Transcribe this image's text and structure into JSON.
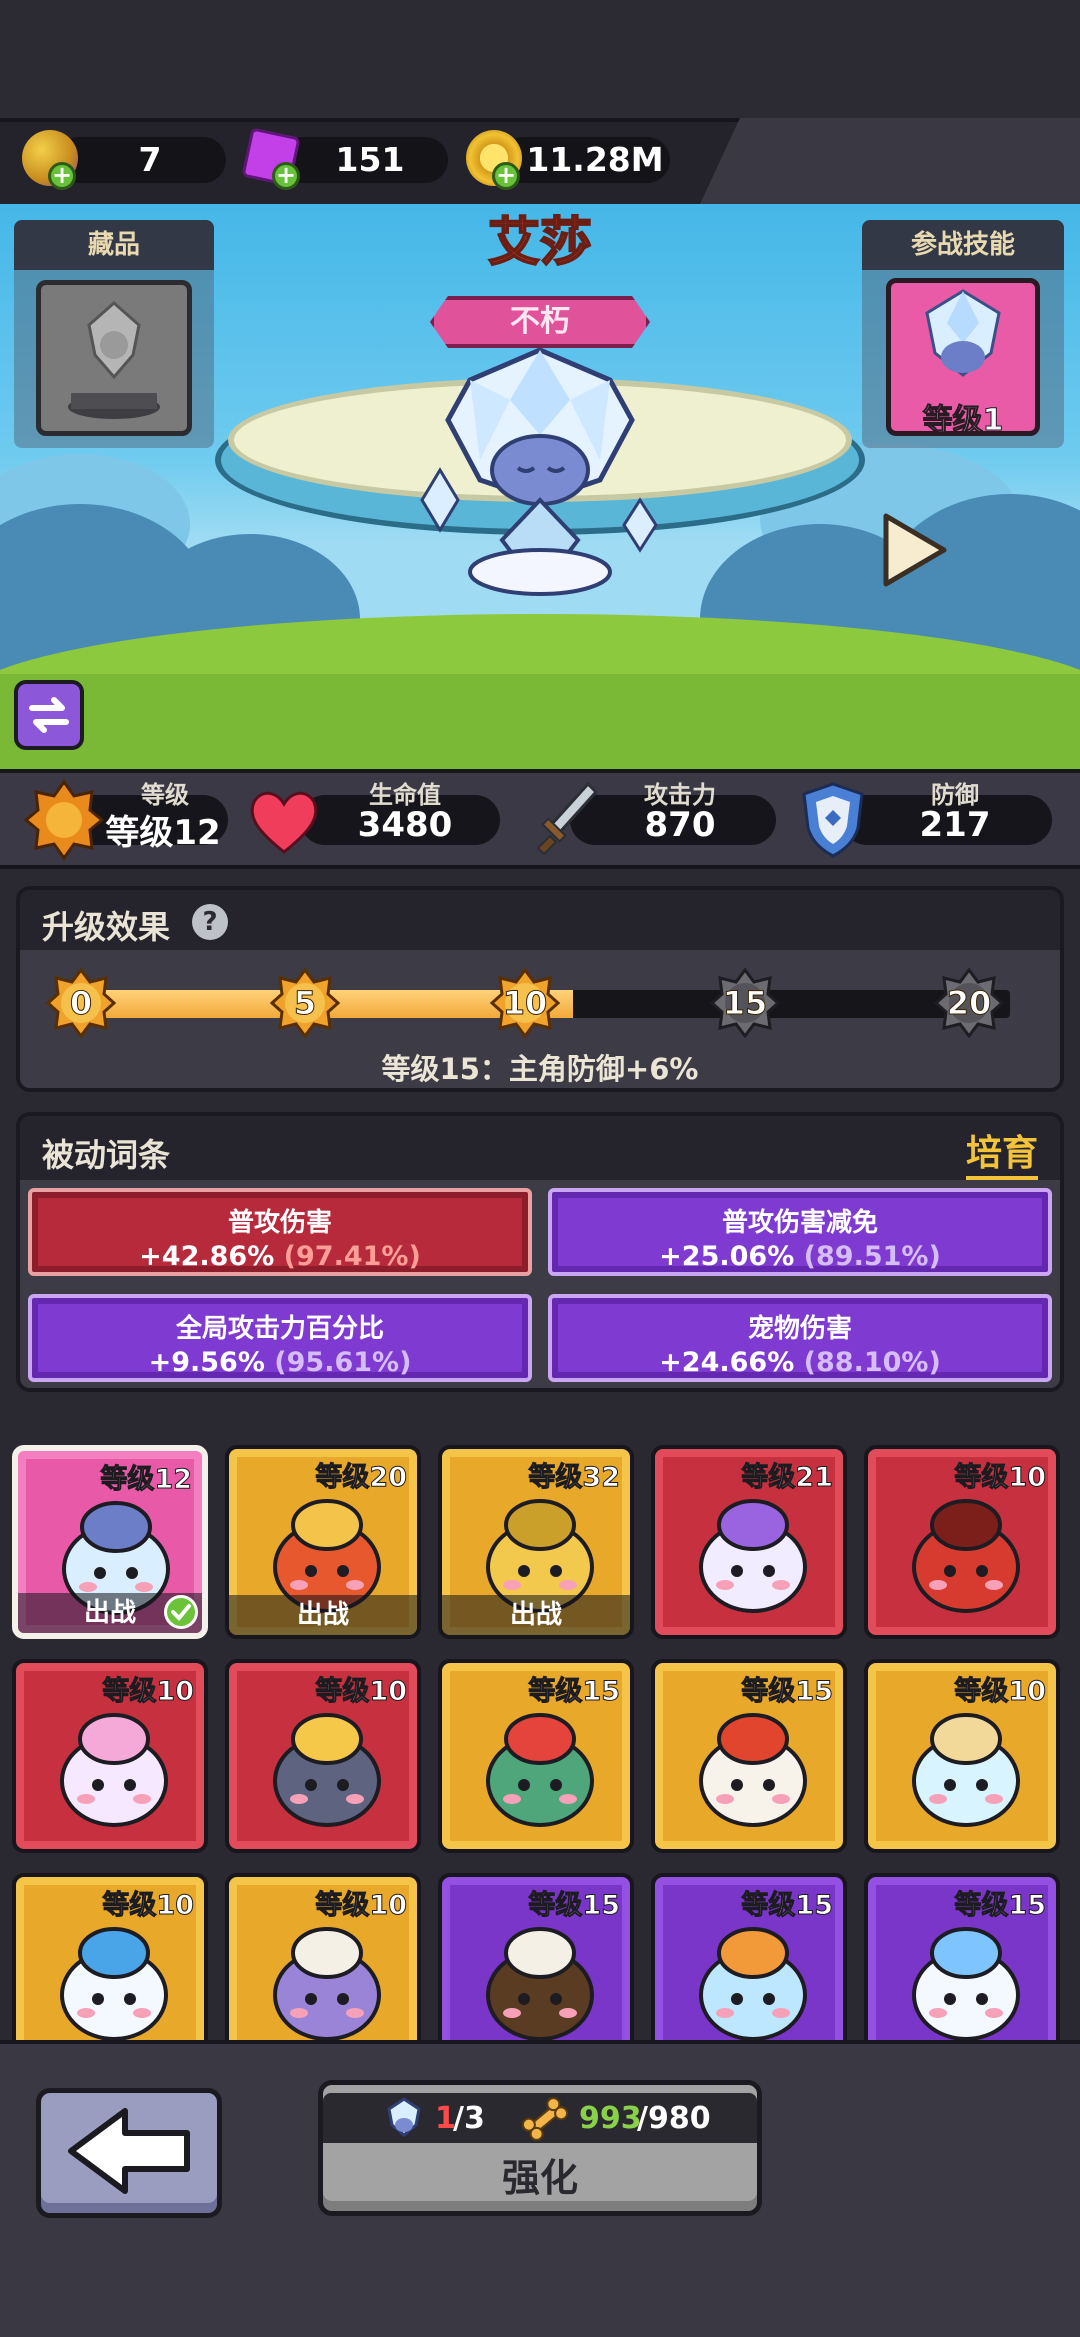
{
  "resources": [
    {
      "icon": "egg-icon",
      "value": "7"
    },
    {
      "icon": "gem-icon",
      "value": "151"
    },
    {
      "icon": "gold-coin-icon",
      "value": "11.28M"
    }
  ],
  "hero": {
    "name": "艾莎",
    "rarity": "不朽",
    "collection_label": "藏品",
    "battle_skill_label": "参战技能",
    "battle_skill_level": "等级1"
  },
  "stats": [
    {
      "label": "等级",
      "value": "等级12",
      "icon": "level-badge-icon"
    },
    {
      "label": "生命值",
      "value": "3480",
      "icon": "heart-icon"
    },
    {
      "label": "攻击力",
      "value": "870",
      "icon": "sword-icon"
    },
    {
      "label": "防御",
      "value": "217",
      "icon": "shield-icon"
    }
  ],
  "upgrade_effect": {
    "title": "升级效果",
    "milestones": [
      "0",
      "5",
      "10",
      "15",
      "20"
    ],
    "progress": 0.53,
    "description": "等级15：主角防御+6%"
  },
  "passive": {
    "title": "被动词条",
    "cultivate_label": "培育",
    "traits": [
      {
        "name": "普攻伤害",
        "value": "+42.86%",
        "pct": "(97.41%)",
        "color": "red"
      },
      {
        "name": "普攻伤害减免",
        "value": "+25.06%",
        "pct": "(89.51%)",
        "color": "purple"
      },
      {
        "name": "全局攻击力百分比",
        "value": "+9.56%",
        "pct": "(95.61%)",
        "color": "purple"
      },
      {
        "name": "宠物伤害",
        "value": "+24.66%",
        "pct": "(88.10%)",
        "color": "purple"
      }
    ]
  },
  "pets": [
    {
      "level": "等级12",
      "color": "pink",
      "battle": "出战",
      "selected": true,
      "art": "ice-crystal-pet-icon"
    },
    {
      "level": "等级20",
      "color": "orange",
      "battle": "出战",
      "art": "king-gorilla-pet-icon"
    },
    {
      "level": "等级32",
      "color": "orange",
      "battle": "出战",
      "art": "yellow-elephant-pet-icon"
    },
    {
      "level": "等级21",
      "color": "red",
      "battle": "",
      "art": "purple-unicorn-pet-icon"
    },
    {
      "level": "等级10",
      "color": "red",
      "battle": "",
      "art": "red-dragon-pet-icon"
    },
    {
      "level": "等级10",
      "color": "red",
      "battle": "",
      "art": "rainbow-slime-pet-icon"
    },
    {
      "level": "等级10",
      "color": "red",
      "battle": "",
      "art": "storm-cloud-pet-icon"
    },
    {
      "level": "等级15",
      "color": "orange",
      "battle": "",
      "art": "cactus-boxer-pet-icon"
    },
    {
      "level": "等级15",
      "color": "orange",
      "battle": "",
      "art": "reindeer-pet-icon"
    },
    {
      "level": "等级10",
      "color": "orange",
      "battle": "",
      "art": "crystal-mushroom-pet-icon"
    },
    {
      "level": "等级10",
      "color": "orange",
      "battle": "",
      "art": "blue-bunny-pet-icon"
    },
    {
      "level": "等级10",
      "color": "orange",
      "battle": "",
      "art": "genie-pet-icon"
    },
    {
      "level": "等级15",
      "color": "purple",
      "battle": "",
      "art": "eagle-pet-icon"
    },
    {
      "level": "等级15",
      "color": "purple",
      "battle": "",
      "art": "bird-pet-icon"
    },
    {
      "level": "等级15",
      "color": "purple",
      "battle": "",
      "art": "snow-mushroom-pet-icon"
    }
  ],
  "bottom": {
    "shards_current": "1",
    "shards_total": "/3",
    "bones_current": "993",
    "bones_total": "/980",
    "upgrade_label": "强化"
  }
}
